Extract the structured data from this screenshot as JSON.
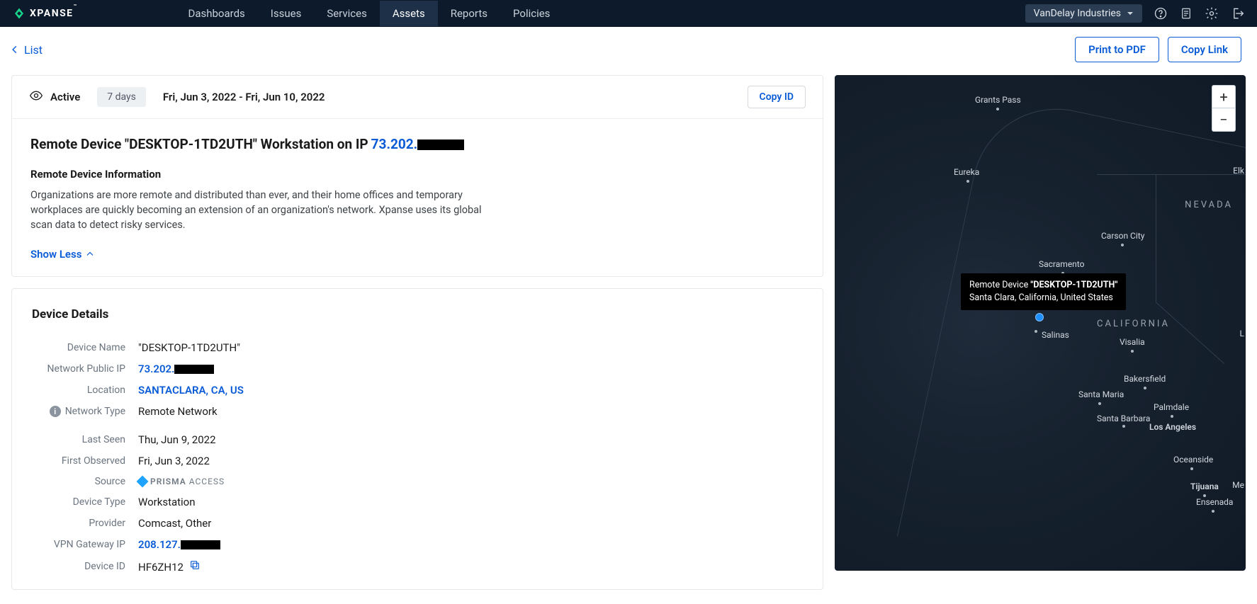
{
  "brand": "XPANSE",
  "nav": {
    "items": [
      "Dashboards",
      "Issues",
      "Services",
      "Assets",
      "Reports",
      "Policies"
    ],
    "active": "Assets"
  },
  "org": "VanDelay Industries",
  "back_label": "List",
  "actions": {
    "print": "Print to PDF",
    "copylink": "Copy Link"
  },
  "summary": {
    "status": "Active",
    "range_pill": "7 days",
    "date_range": "Fri, Jun 3, 2022 - Fri, Jun 10, 2022",
    "copy_id": "Copy ID",
    "title_prefix": "Remote Device \"DESKTOP-1TD2UTH\" Workstation on IP ",
    "title_ip_visible": "73.202.",
    "section_title": "Remote Device Information",
    "description": "Organizations are more remote and distributed than ever, and their home offices and temporary workplaces are quickly becoming an extension of an organization's network. Xpanse uses its global scan data to detect risky services.",
    "show_less": "Show Less"
  },
  "details": {
    "title": "Device Details",
    "rows": {
      "device_name": {
        "label": "Device Name",
        "value": "\"DESKTOP-1TD2UTH\""
      },
      "public_ip": {
        "label": "Network Public IP",
        "value": "73.202."
      },
      "location": {
        "label": "Location",
        "value": "SANTACLARA, CA, US"
      },
      "net_type": {
        "label": "Network Type",
        "value": "Remote Network"
      },
      "last_seen": {
        "label": "Last Seen",
        "value": "Thu, Jun 9, 2022"
      },
      "first_obs": {
        "label": "First Observed",
        "value": "Fri, Jun 3, 2022"
      },
      "source": {
        "label": "Source",
        "value_brand": "PRISMA",
        "value_sub": "ACCESS"
      },
      "dev_type": {
        "label": "Device Type",
        "value": "Workstation"
      },
      "provider": {
        "label": "Provider",
        "value": "Comcast, Other"
      },
      "vpn_ip": {
        "label": "VPN Gateway IP",
        "value": "208.127."
      },
      "device_id": {
        "label": "Device ID",
        "value": "HF6ZH12"
      }
    }
  },
  "map": {
    "tooltip_line1_pre": "Remote Device ",
    "tooltip_line1_bold": "\"DESKTOP-1TD2UTH\"",
    "tooltip_line2": "Santa Clara, California, United States",
    "labels": {
      "grants_pass": "Grants Pass",
      "eureka": "Eureka",
      "elk": "Elk",
      "nevada": "NEVADA",
      "carson": "Carson City",
      "sacramento": "Sacramento",
      "california": "CALIFORNIA",
      "salinas": "Salinas",
      "visalia": "Visalia",
      "l": "L",
      "bakersfield": "Bakersfield",
      "santa_maria": "Santa Maria",
      "palmdale": "Palmdale",
      "santa_barbara": "Santa Barbara",
      "la": "Los Angeles",
      "oceanside": "Oceanside",
      "tijuana": "Tijuana",
      "me": "Me",
      "ensenada": "Ensenada"
    }
  }
}
